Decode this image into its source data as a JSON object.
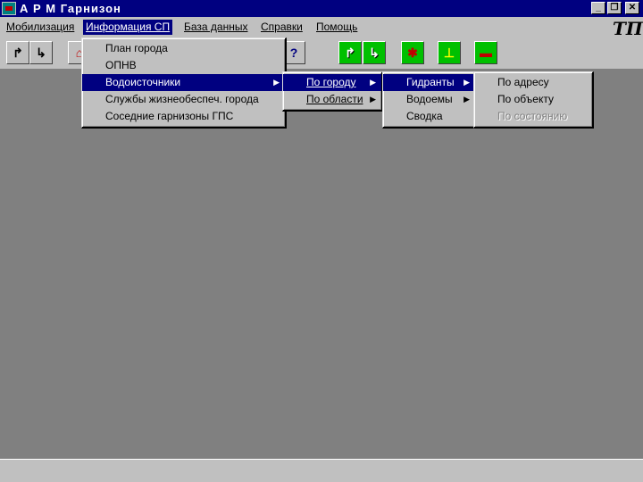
{
  "window": {
    "title": "А Р М   Гарнизон",
    "minimize_icon": "_",
    "restore_icon": "❐",
    "close_icon": "✕"
  },
  "menubar": {
    "items": [
      {
        "label": "Мобилизация"
      },
      {
        "label": "Информация СП"
      },
      {
        "label": "База данных"
      },
      {
        "label": "Справки"
      },
      {
        "label": "Помощь"
      }
    ]
  },
  "toolbar": {
    "logo": "ТП",
    "help_glyph": "?"
  },
  "menu_info": {
    "items": [
      {
        "label": "План города"
      },
      {
        "label": "ОПНВ"
      },
      {
        "label": "Водоисточники",
        "arrow": "▶"
      },
      {
        "label": "Службы жизнеобеспеч. города"
      },
      {
        "label": "Соседние гарнизоны ГПС"
      }
    ]
  },
  "menu_water": {
    "items": [
      {
        "label": "По городу",
        "arrow": "▶"
      },
      {
        "label": "По области",
        "arrow": "▶"
      }
    ]
  },
  "menu_city": {
    "items": [
      {
        "label": "Гидранты",
        "arrow": "▶"
      },
      {
        "label": "Водоемы",
        "arrow": "▶"
      },
      {
        "label": "Сводка"
      }
    ]
  },
  "menu_hydrants": {
    "items": [
      {
        "label": "По адресу"
      },
      {
        "label": "По объекту"
      },
      {
        "label": "По состоянию"
      }
    ]
  },
  "colors": {
    "titlebar": "#000080",
    "highlight": "#000080",
    "face": "#c0c0c0",
    "workspace": "#808080",
    "tool_green": "#00c000"
  }
}
